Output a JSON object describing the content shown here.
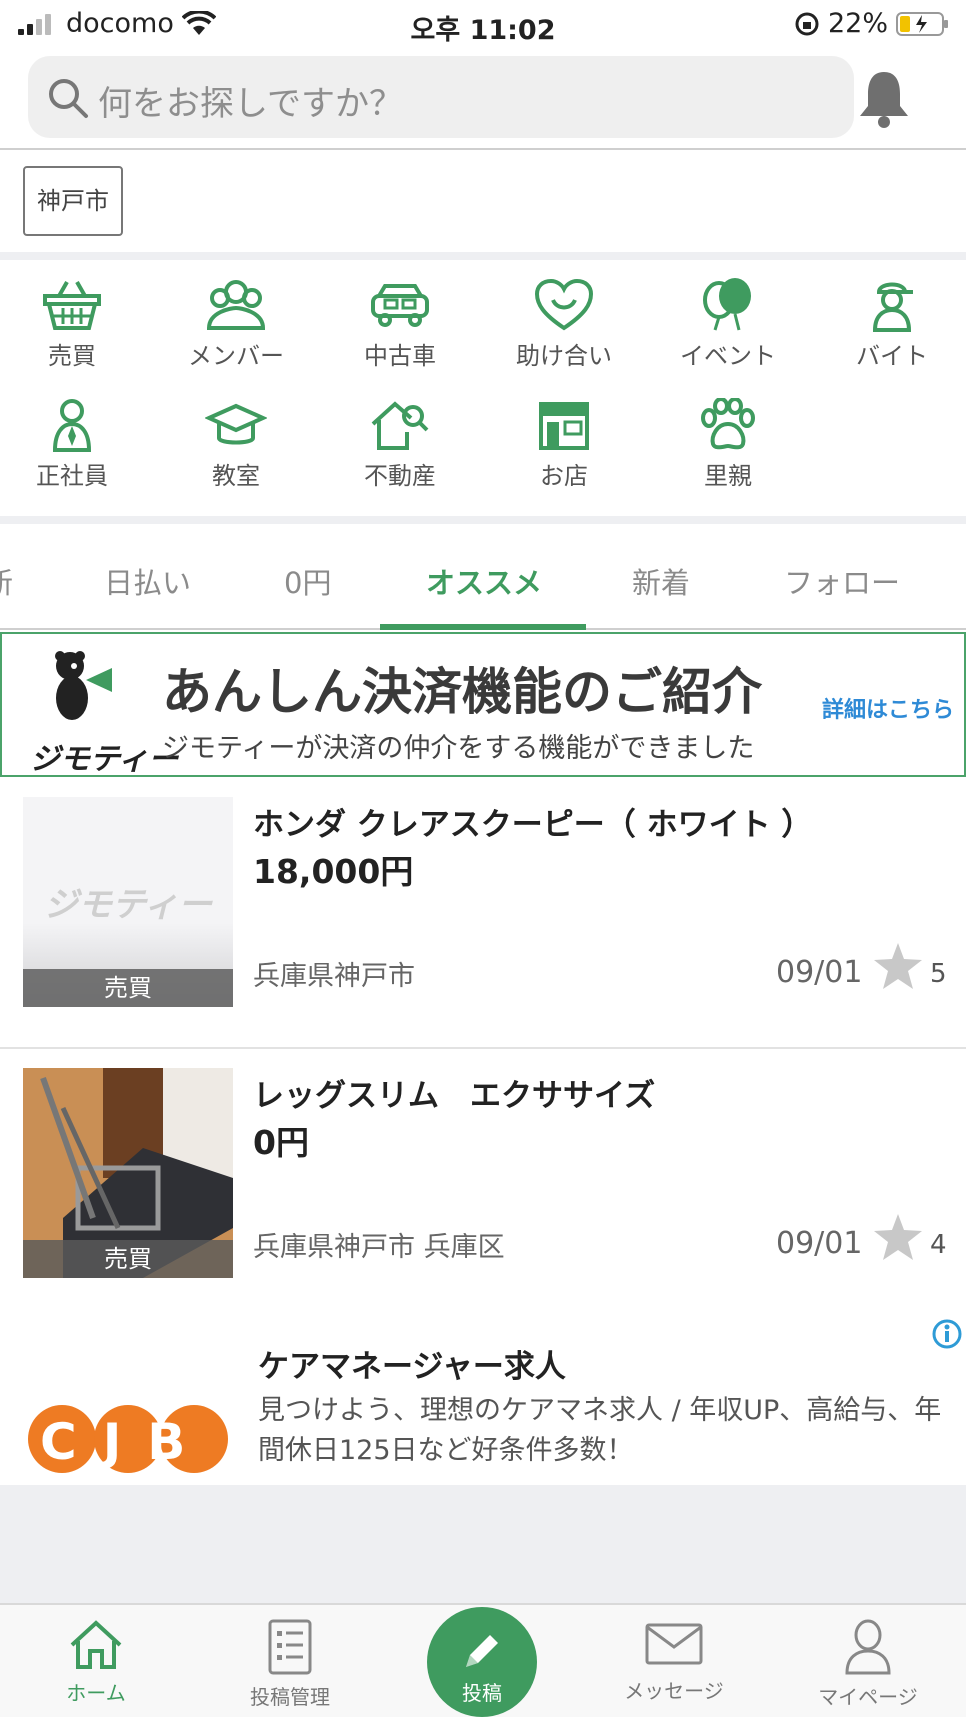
{
  "status_bar": {
    "carrier": "docomo",
    "time": "오후 11:02",
    "battery": "22%"
  },
  "search": {
    "placeholder": "何をお探しですか？"
  },
  "location": {
    "chip": "神戸市"
  },
  "categories": [
    {
      "label": "売買",
      "icon": "basket-icon"
    },
    {
      "label": "メンバー",
      "icon": "members-icon"
    },
    {
      "label": "中古車",
      "icon": "car-icon"
    },
    {
      "label": "助け合い",
      "icon": "heart-icon"
    },
    {
      "label": "イベント",
      "icon": "balloon-icon"
    },
    {
      "label": "バイト",
      "icon": "parttime-icon"
    },
    {
      "label": "正社員",
      "icon": "employee-icon"
    },
    {
      "label": "教室",
      "icon": "mortarboard-icon"
    },
    {
      "label": "不動産",
      "icon": "house-icon"
    },
    {
      "label": "お店",
      "icon": "shop-icon"
    },
    {
      "label": "里親",
      "icon": "paw-icon"
    }
  ],
  "tabs": {
    "partial": "新",
    "items": [
      "日払い",
      "0円",
      "オススメ",
      "新着",
      "フォロー"
    ],
    "active": "オススメ"
  },
  "banner": {
    "title": "あんしん決済機能のご紹介",
    "subtitle": "ジモティーが決済の仲介をする機能ができました",
    "link": "詳細はこちら",
    "brand": "ジモティー"
  },
  "listings": [
    {
      "title": "ホンダ クレアスクーピー（ ホワイト ）",
      "price": "18,000円",
      "location": "兵庫県神戸市",
      "date": "09/01",
      "favorites": "5",
      "category": "売買",
      "thumb_text": "ジモティー"
    },
    {
      "title": "レッグスリム　エクササイズ",
      "price": "0円",
      "location": "兵庫県神戸市 兵庫区",
      "date": "09/01",
      "favorites": "4",
      "category": "売買"
    }
  ],
  "ad": {
    "logo": "CJB",
    "title": "ケアマネージャー求人",
    "description": "見つけよう、理想のケアマネ求人 / 年収UP、高給与、年間休日125日など好条件多数！"
  },
  "bottom_nav": {
    "home": "ホーム",
    "manage": "投稿管理",
    "post": "投稿",
    "messages": "メッセージ",
    "mypage": "マイページ"
  },
  "colors": {
    "accent": "#3f9b5f",
    "link": "#2e8ad6"
  }
}
